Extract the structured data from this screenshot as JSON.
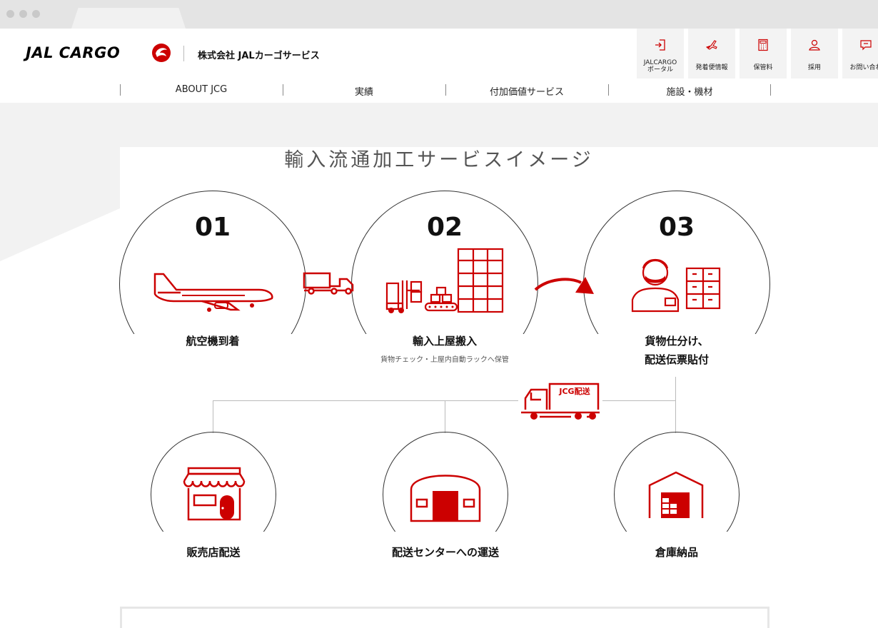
{
  "header": {
    "logo_text": "JAL CARGO",
    "company_name": "株式会社 JALカーゴサービス",
    "util_links": [
      {
        "label_1": "JALCARGO",
        "label_2": "ポータル",
        "icon": "door-exit-icon"
      },
      {
        "label": "発着便情報",
        "icon": "airplane-icon"
      },
      {
        "label": "保管料",
        "icon": "calculator-icon"
      },
      {
        "label": "採用",
        "icon": "person-icon"
      },
      {
        "label": "お問い合わ",
        "icon": "chat-icon"
      }
    ]
  },
  "nav": {
    "items": [
      {
        "label": "ABOUT JCG"
      },
      {
        "label": "実績"
      },
      {
        "label": "付加価値サービス"
      },
      {
        "label": "施設・機材"
      }
    ]
  },
  "content": {
    "title": "輸入流通加工サービスイメージ",
    "steps": [
      {
        "number": "01",
        "label": "航空機到着"
      },
      {
        "number": "02",
        "label": "輸入上屋搬入",
        "sub": "貨物チェック・上屋内自動ラックへ保管"
      },
      {
        "number": "03",
        "label_1": "貨物仕分け、",
        "label_2": "配送伝票貼付"
      }
    ],
    "truck_badge": "JCG配送",
    "destinations": [
      {
        "label": "販売店配送",
        "icon": "shop-icon"
      },
      {
        "label": "配送センターへの運送",
        "icon": "distribution-center-icon"
      },
      {
        "label": "倉庫納品",
        "icon": "warehouse-icon"
      }
    ]
  },
  "colors": {
    "accent_red": "#cc0000",
    "text": "#222222",
    "background_gray": "#f0f0f0"
  }
}
